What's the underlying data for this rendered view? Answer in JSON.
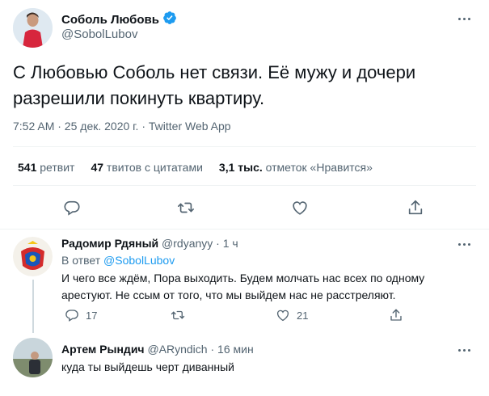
{
  "tweet": {
    "author_name": "Соболь Любовь",
    "author_handle": "@SobolLubov",
    "text_line1": "С Любовью Соболь нет связи. Её мужу и дочери",
    "text_line2": "разрешили покинуть квартиру.",
    "timestamp": "7:52 AM · 25 дек. 2020 г. · Twitter Web App",
    "retweets_count": "541",
    "retweets_label": "ретвит",
    "quotes_count": "47",
    "quotes_label": "твитов с цитатами",
    "likes_count": "3,1 тыс.",
    "likes_label": "отметок «Нравится»"
  },
  "replies": [
    {
      "name": "Радомир Рдяный",
      "handle": "@rdyanyy",
      "time": "· 1 ч",
      "reply_to_prefix": "В ответ",
      "reply_to_handle": "@SobolLubov",
      "text_line1": "И чего все ждём, Пора выходить. Будем молчать нас всех по одному",
      "text_line2": "арестуют. Не ссым от того, что мы выйдем нас не расстреляют.",
      "reply_count": "17",
      "like_count": "21"
    },
    {
      "name": "Артем Рындич",
      "handle": "@ARyndich",
      "time": "· 16 мин",
      "text_line1": "куда ты выйдешь черт диванный"
    }
  ],
  "icons": {
    "verified": "verified-badge-icon",
    "more": "more-icon",
    "reply": "reply-icon",
    "retweet": "retweet-icon",
    "like": "like-icon",
    "share": "share-icon"
  },
  "colors": {
    "accent": "#1d9bf0",
    "text": "#0f1419",
    "muted": "#536471",
    "divider": "#eff3f4"
  }
}
